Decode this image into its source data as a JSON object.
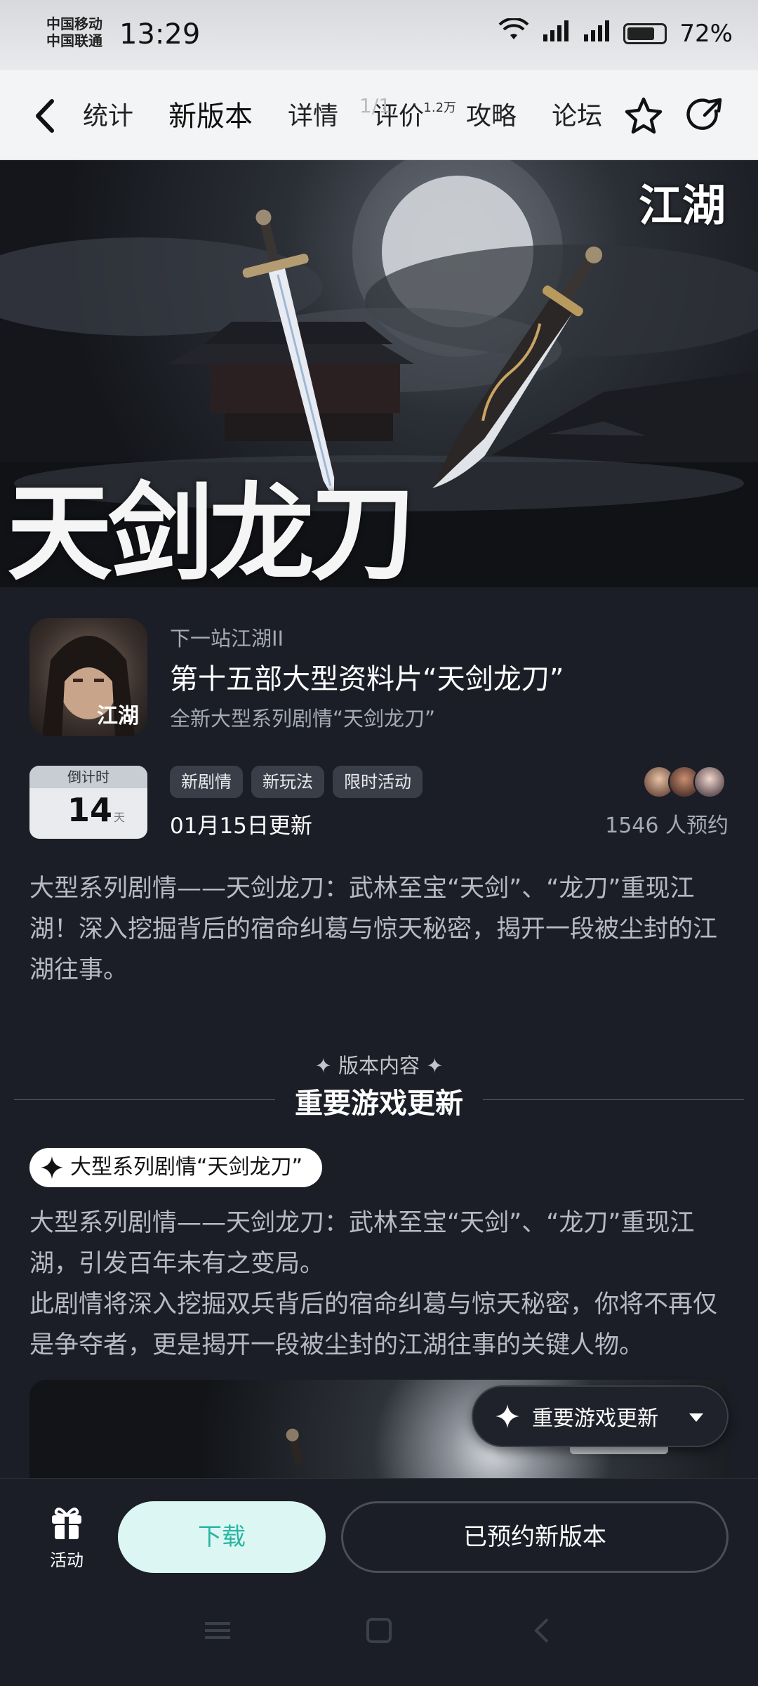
{
  "status_bar": {
    "carrier_1": "中国移动",
    "carrier_2": "中国联通",
    "time": "13:29",
    "battery": "72%"
  },
  "nav": {
    "tabs": [
      {
        "label": "统计"
      },
      {
        "label": "新版本",
        "active": true
      },
      {
        "label": "详情"
      },
      {
        "label": "评价",
        "badge": "1.2万"
      },
      {
        "label": "攻略"
      },
      {
        "label": "论坛"
      }
    ],
    "page_indicator": "1/1"
  },
  "hero": {
    "title": "天剑龙刀",
    "logo": "江湖"
  },
  "game": {
    "name": "下一站江湖II",
    "icon_text": "江湖",
    "version_title": "第十五部大型资料片“天剑龙刀”",
    "version_subtitle": "全新大型系列剧情“天剑龙刀”"
  },
  "countdown": {
    "label": "倒计时",
    "number": "14",
    "unit": "天"
  },
  "tags": [
    "新剧情",
    "新玩法",
    "限时活动"
  ],
  "update_date": "01月15日更新",
  "reserve_count": "1546 人预约",
  "intro": "大型系列剧情——天剑龙刀：武林至宝“天剑”、“龙刀”重现江湖！深入挖掘背后的宿命纠葛与惊天秘密，揭开一段被尘封的江湖往事。",
  "section": {
    "small_title": "版本内容",
    "title": "重要游戏更新"
  },
  "content": {
    "pill_label": "大型系列剧情“天剑龙刀”",
    "paragraph_1": "大型系列剧情——天剑龙刀：武林至宝“天剑”、“龙刀”重现江湖，引发百年未有之变局。",
    "paragraph_2": "此剧情将深入挖掘双兵背后的宿命纠葛与惊天秘密，你将不再仅是争夺者，更是揭开一段被尘封的江湖往事的关键人物。"
  },
  "floating_pill": {
    "label": "重要游戏更新"
  },
  "bottom": {
    "activity_label": "活动",
    "download_label": "下载",
    "reserved_label": "已预约新版本"
  },
  "colors": {
    "background": "#1b1e27",
    "accent": "#2ac2b0",
    "download_bg": "#dcf7f3",
    "download_text": "#2ab5a3"
  },
  "icons": {
    "back": "back-arrow-icon",
    "star": "star-icon",
    "share": "share-icon",
    "sparkle": "sparkle-icon",
    "gift": "gift-icon",
    "caret": "chevron-down-icon"
  }
}
